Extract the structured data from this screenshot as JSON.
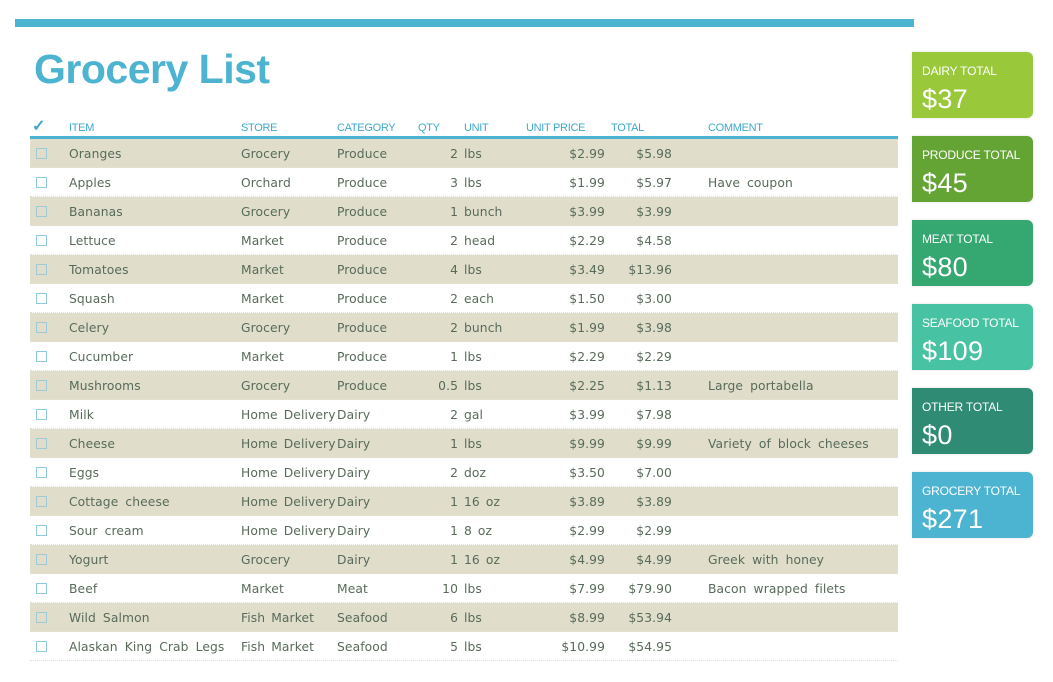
{
  "title": "Grocery List",
  "colors": {
    "accent": "#4cb3d1",
    "row_shade": "#e0ddcb",
    "dairy": "#99c83a",
    "produce": "#64a434",
    "meat": "#35a872",
    "seafood": "#47c2a2",
    "other": "#2f8b73",
    "grocery": "#4cb3d1"
  },
  "table": {
    "headers": {
      "check": "✓",
      "item": "ITEM",
      "store": "STORE",
      "category": "CATEGORY",
      "qty": "QTY",
      "unit": "UNIT",
      "unit_price": "UNIT PRICE",
      "total": "TOTAL",
      "comment": "COMMENT"
    },
    "rows": [
      {
        "checked": false,
        "item": "Oranges",
        "store": "Grocery",
        "category": "Produce",
        "qty": "2",
        "unit": "lbs",
        "unit_price": "$2.99",
        "total": "$5.98",
        "comment": ""
      },
      {
        "checked": false,
        "item": "Apples",
        "store": "Orchard",
        "category": "Produce",
        "qty": "3",
        "unit": "lbs",
        "unit_price": "$1.99",
        "total": "$5.97",
        "comment": "Have coupon"
      },
      {
        "checked": false,
        "item": "Bananas",
        "store": "Grocery",
        "category": "Produce",
        "qty": "1",
        "unit": "bunch",
        "unit_price": "$3.99",
        "total": "$3.99",
        "comment": ""
      },
      {
        "checked": false,
        "item": "Lettuce",
        "store": "Market",
        "category": "Produce",
        "qty": "2",
        "unit": "head",
        "unit_price": "$2.29",
        "total": "$4.58",
        "comment": ""
      },
      {
        "checked": false,
        "item": "Tomatoes",
        "store": "Market",
        "category": "Produce",
        "qty": "4",
        "unit": "lbs",
        "unit_price": "$3.49",
        "total": "$13.96",
        "comment": ""
      },
      {
        "checked": false,
        "item": "Squash",
        "store": "Market",
        "category": "Produce",
        "qty": "2",
        "unit": "each",
        "unit_price": "$1.50",
        "total": "$3.00",
        "comment": ""
      },
      {
        "checked": false,
        "item": "Celery",
        "store": "Grocery",
        "category": "Produce",
        "qty": "2",
        "unit": "bunch",
        "unit_price": "$1.99",
        "total": "$3.98",
        "comment": ""
      },
      {
        "checked": false,
        "item": "Cucumber",
        "store": "Market",
        "category": "Produce",
        "qty": "1",
        "unit": "lbs",
        "unit_price": "$2.29",
        "total": "$2.29",
        "comment": ""
      },
      {
        "checked": false,
        "item": "Mushrooms",
        "store": "Grocery",
        "category": "Produce",
        "qty": "0.5",
        "unit": "lbs",
        "unit_price": "$2.25",
        "total": "$1.13",
        "comment": "Large portabella"
      },
      {
        "checked": false,
        "item": "Milk",
        "store": "Home Delivery",
        "category": "Dairy",
        "qty": "2",
        "unit": "gal",
        "unit_price": "$3.99",
        "total": "$7.98",
        "comment": ""
      },
      {
        "checked": false,
        "item": "Cheese",
        "store": "Home Delivery",
        "category": "Dairy",
        "qty": "1",
        "unit": "lbs",
        "unit_price": "$9.99",
        "total": "$9.99",
        "comment": "Variety of block cheeses"
      },
      {
        "checked": false,
        "item": "Eggs",
        "store": "Home Delivery",
        "category": "Dairy",
        "qty": "2",
        "unit": "doz",
        "unit_price": "$3.50",
        "total": "$7.00",
        "comment": ""
      },
      {
        "checked": false,
        "item": "Cottage cheese",
        "store": "Home Delivery",
        "category": "Dairy",
        "qty": "1",
        "unit": "16 oz",
        "unit_price": "$3.89",
        "total": "$3.89",
        "comment": ""
      },
      {
        "checked": false,
        "item": "Sour cream",
        "store": "Home Delivery",
        "category": "Dairy",
        "qty": "1",
        "unit": "8 oz",
        "unit_price": "$2.99",
        "total": "$2.99",
        "comment": ""
      },
      {
        "checked": false,
        "item": "Yogurt",
        "store": "Grocery",
        "category": "Dairy",
        "qty": "1",
        "unit": "16 oz",
        "unit_price": "$4.99",
        "total": "$4.99",
        "comment": "Greek with honey"
      },
      {
        "checked": false,
        "item": "Beef",
        "store": "Market",
        "category": "Meat",
        "qty": "10",
        "unit": "lbs",
        "unit_price": "$7.99",
        "total": "$79.90",
        "comment": "Bacon wrapped filets"
      },
      {
        "checked": false,
        "item": "Wild Salmon",
        "store": "Fish Market",
        "category": "Seafood",
        "qty": "6",
        "unit": "lbs",
        "unit_price": "$8.99",
        "total": "$53.94",
        "comment": ""
      },
      {
        "checked": false,
        "item": "Alaskan King Crab Legs",
        "store": "Fish Market",
        "category": "Seafood",
        "qty": "5",
        "unit": "lbs",
        "unit_price": "$10.99",
        "total": "$54.95",
        "comment": ""
      }
    ]
  },
  "totals": [
    {
      "key": "dairy",
      "label": "DAIRY TOTAL",
      "value": "$37"
    },
    {
      "key": "produce",
      "label": "PRODUCE TOTAL",
      "value": "$45"
    },
    {
      "key": "meat",
      "label": "MEAT TOTAL",
      "value": "$80"
    },
    {
      "key": "seafood",
      "label": "SEAFOOD TOTAL",
      "value": "$109"
    },
    {
      "key": "other",
      "label": "OTHER TOTAL",
      "value": "$0"
    },
    {
      "key": "grocery",
      "label": "GROCERY TOTAL",
      "value": "$271"
    }
  ]
}
